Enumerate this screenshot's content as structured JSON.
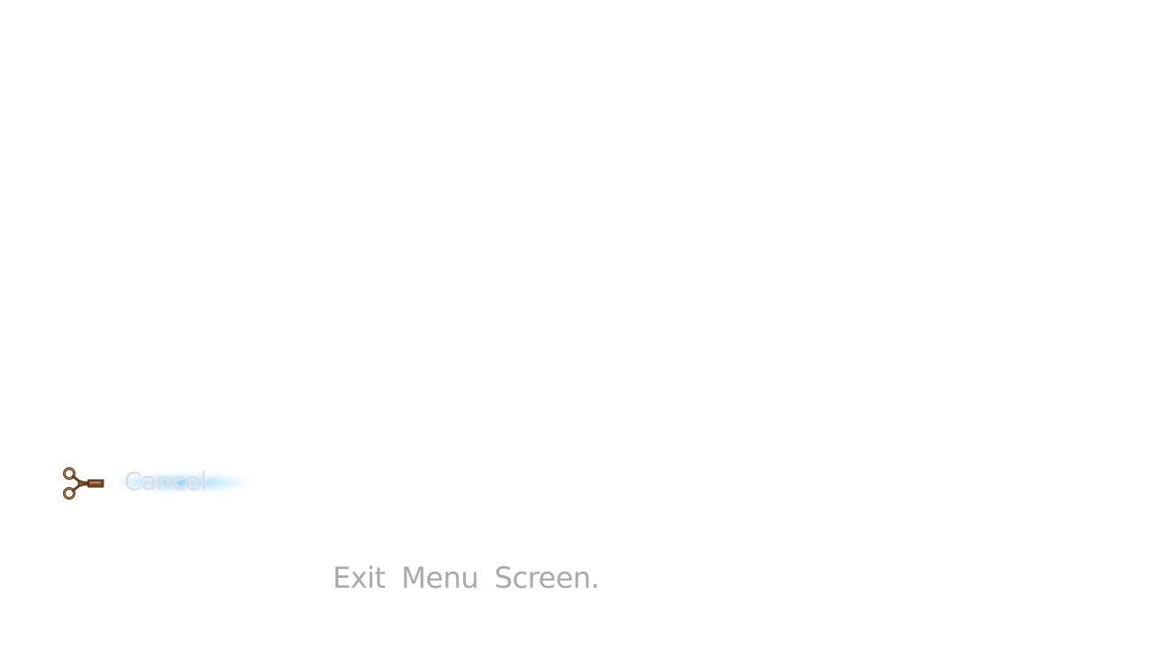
{
  "menu": {
    "options": [
      {
        "label": "Cancel",
        "icon": "scissors-icon",
        "selected": true
      }
    ],
    "help_text": "Exit Menu Screen."
  },
  "colors": {
    "background": "#ffffff",
    "option_text": "#dcdcdc",
    "help_text": "#a9a9a9",
    "highlight_glow": "#78c8ff",
    "icon_brown": "#7a4a22"
  }
}
